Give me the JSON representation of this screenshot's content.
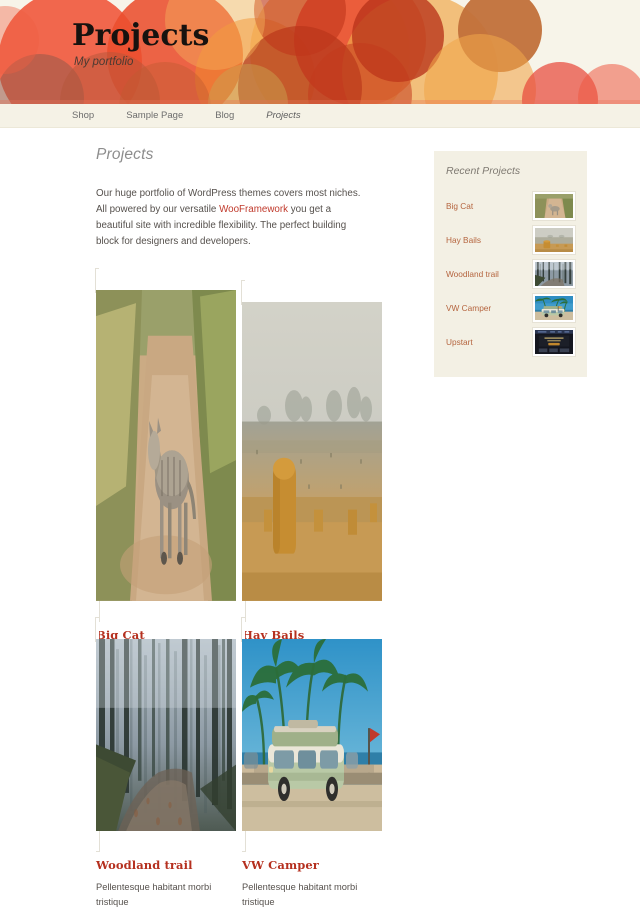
{
  "site": {
    "title": "Projects",
    "tagline": "My portfolio"
  },
  "nav": {
    "items": [
      {
        "label": "Shop",
        "current": false
      },
      {
        "label": "Sample Page",
        "current": false
      },
      {
        "label": "Blog",
        "current": false
      },
      {
        "label": "Projects",
        "current": true
      }
    ]
  },
  "main": {
    "page_title": "Projects",
    "intro_part1": "Our huge portfolio of WordPress themes covers most niches. All powered by our versatile ",
    "intro_link": "WooFramework",
    "intro_part2": " you get a beautiful site with incredible flexibility. The perfect building block for designers and developers.",
    "excerpt": "Pellentesque habitant morbi tristique senectus et netus et malesuada fames ac turpis egestas. Vestibulum tortor quam, feugiat vitae, ultricies eget, tempor sit amet, ante. Donec eu libero sit amet quam egestas semper. Aenean ultricies mi vitae est. Mauris placerat eleifend leo.",
    "excerpt_short": "Pellentesque habitant morbi tristique",
    "projects": [
      {
        "title": "Big Cat",
        "image": "wildcat-on-dirt-road"
      },
      {
        "title": "Hay Bails",
        "image": "hay-bales-misty-field"
      },
      {
        "title": "Woodland trail",
        "image": "misty-forest-trail"
      },
      {
        "title": "VW Camper",
        "image": "vw-camper-palm-trees"
      }
    ]
  },
  "sidebar": {
    "heading": "Recent Projects",
    "items": [
      {
        "label": "Big Cat",
        "image": "wildcat-on-dirt-road"
      },
      {
        "label": "Hay Bails",
        "image": "hay-bales-misty-field"
      },
      {
        "label": "Woodland trail",
        "image": "misty-forest-trail"
      },
      {
        "label": "VW Camper",
        "image": "vw-camper-palm-trees"
      },
      {
        "label": "Upstart",
        "image": "dark-website-screenshot"
      }
    ]
  },
  "colors": {
    "accent_red": "#b5301f",
    "link_red": "#c0392b",
    "sidebar_link": "#b5653f",
    "banner_bg": "#f7f4e9",
    "nav_bg": "#f5f2e6",
    "sidebar_bg": "#f3f0e4",
    "body_text": "#56514d"
  }
}
